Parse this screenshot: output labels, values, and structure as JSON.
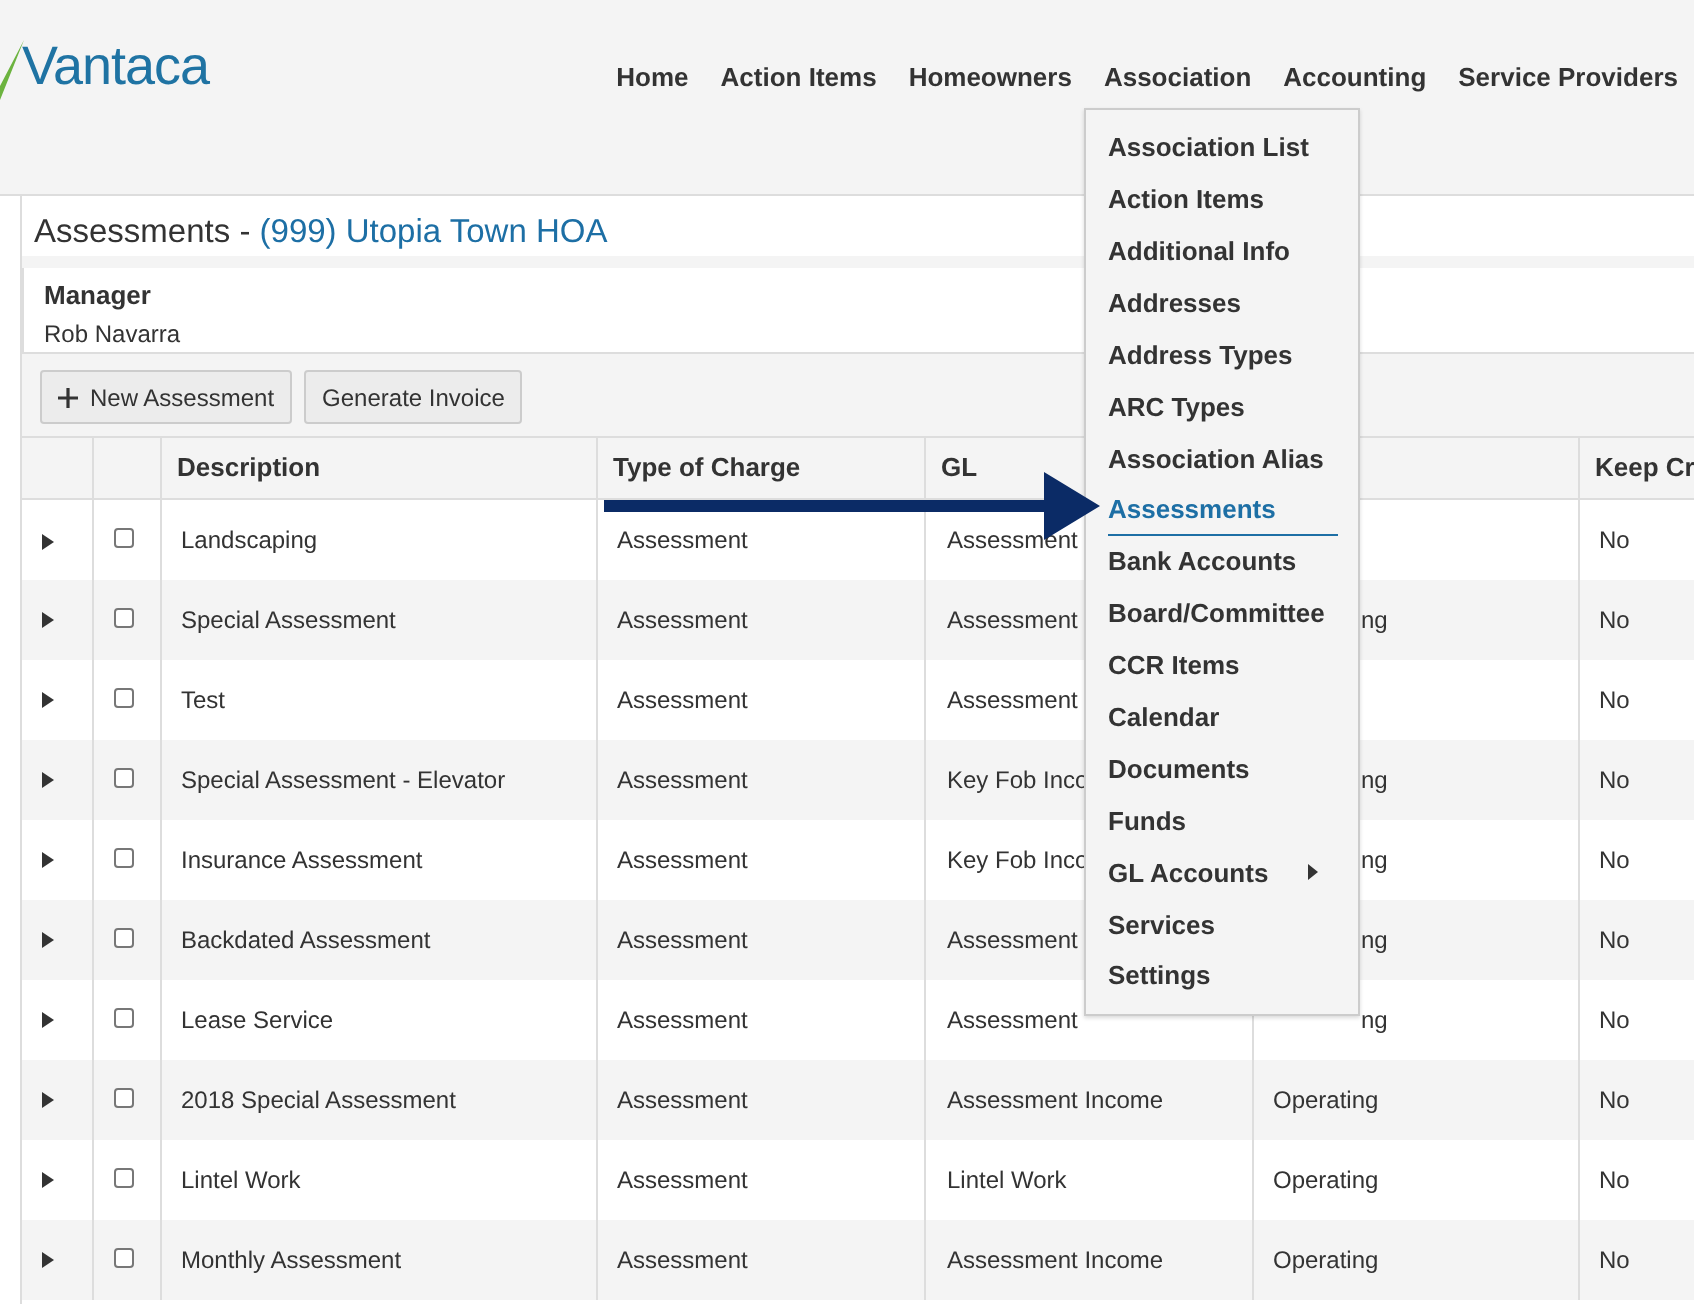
{
  "logo": {
    "text": "Vantaca"
  },
  "nav": [
    {
      "label": "Home"
    },
    {
      "label": "Action Items"
    },
    {
      "label": "Homeowners"
    },
    {
      "label": "Association"
    },
    {
      "label": "Accounting"
    },
    {
      "label": "Service Providers"
    }
  ],
  "page_title": {
    "prefix": "Assessments - ",
    "association": "(999) Utopia Town HOA"
  },
  "manager": {
    "label": "Manager",
    "name": "Rob Navarra"
  },
  "toolbar": [
    {
      "label": "New Assessment",
      "kind": "add"
    },
    {
      "label": "Generate Invoice",
      "kind": "plain"
    }
  ],
  "table": {
    "columns": [
      "Description",
      "Type of Charge",
      "GL",
      null,
      "Keep Cr"
    ],
    "rows": [
      {
        "checked": false,
        "cells": [
          "Landscaping",
          "Assessment",
          "Assessment",
          null,
          "No"
        ]
      },
      {
        "checked": false,
        "under_menu": true,
        "cells": [
          "Special Assessment",
          "Assessment",
          "Assessment",
          "ng",
          "No"
        ]
      },
      {
        "checked": false,
        "cells": [
          "Test",
          "Assessment",
          "Assessment",
          null,
          "No"
        ]
      },
      {
        "checked": false,
        "under_menu": true,
        "cells": [
          "Special Assessment - Elevator",
          "Assessment",
          "Key Fob Inco",
          "ng",
          "No"
        ]
      },
      {
        "checked": false,
        "under_menu": true,
        "cells": [
          "Insurance Assessment",
          "Assessment",
          "Key Fob Inco",
          "ng",
          "No"
        ]
      },
      {
        "checked": false,
        "under_menu": true,
        "cells": [
          "Backdated Assessment",
          "Assessment",
          "Assessment",
          "ng",
          "No"
        ]
      },
      {
        "checked": false,
        "under_menu": true,
        "cells": [
          "Lease Service",
          "Assessment",
          "Assessment",
          "ng",
          "No"
        ]
      },
      {
        "checked": false,
        "cells": [
          "2018 Special Assessment",
          "Assessment",
          "Assessment Income",
          "Operating",
          "No"
        ]
      },
      {
        "checked": false,
        "cells": [
          "Lintel Work",
          "Assessment",
          "Lintel Work",
          "Operating",
          "No"
        ]
      },
      {
        "checked": false,
        "cells": [
          "Monthly Assessment",
          "Assessment",
          "Assessment Income",
          "Operating",
          "No"
        ]
      }
    ]
  },
  "dropdown": {
    "items": [
      {
        "label": "Association List",
        "selected": false
      },
      {
        "label": "Action Items",
        "selected": false
      },
      {
        "label": "Additional Info",
        "selected": false
      },
      {
        "label": "Addresses",
        "selected": false
      },
      {
        "label": "Address Types",
        "selected": false
      },
      {
        "label": "ARC Types",
        "selected": false
      },
      {
        "label": "Association Alias",
        "selected": false
      },
      {
        "label": "Assessments",
        "selected": true
      },
      {
        "label": "Bank Accounts",
        "selected": false
      },
      {
        "label": "Board/Committee",
        "selected": false
      },
      {
        "label": "CCR Items",
        "selected": false
      },
      {
        "label": "Calendar",
        "selected": false
      },
      {
        "label": "Documents",
        "selected": false
      },
      {
        "label": "Funds",
        "selected": false
      },
      {
        "label": "GL Accounts",
        "selected": false,
        "submenu": true
      },
      {
        "label": "Services",
        "selected": false
      },
      {
        "label": "Settings",
        "selected": false
      }
    ]
  }
}
